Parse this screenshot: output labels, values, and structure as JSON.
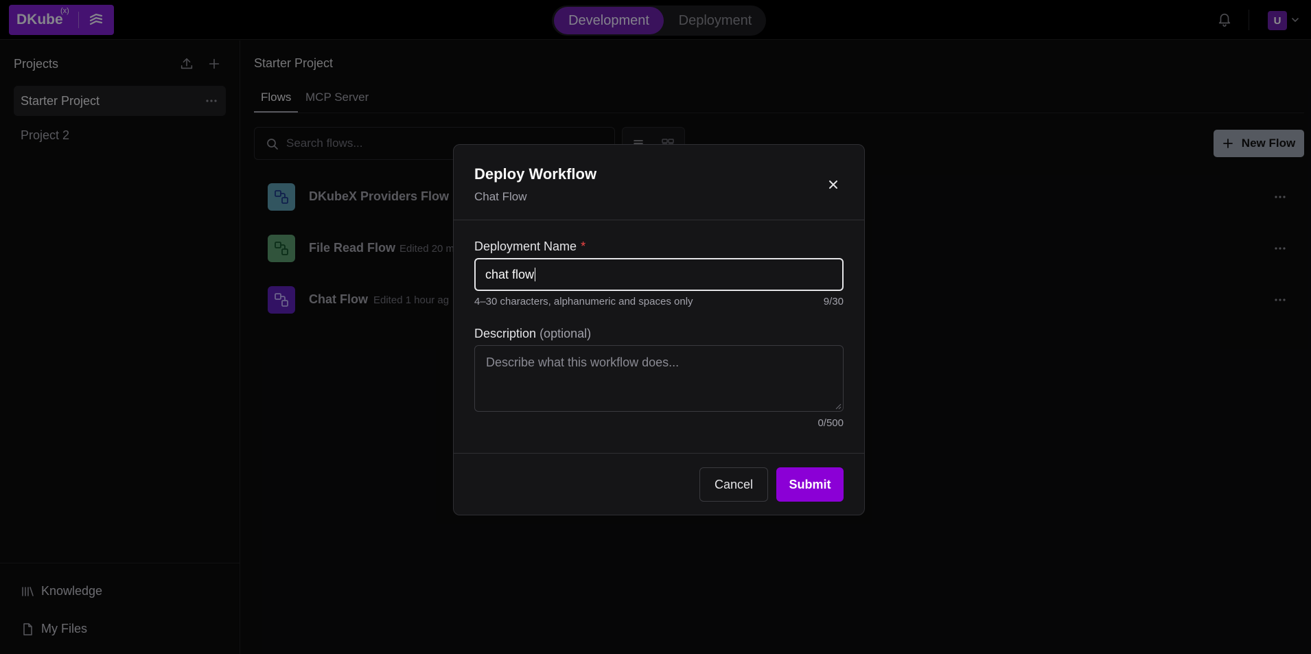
{
  "colors": {
    "brand": "#7e22ce",
    "submit": "#8b00d6",
    "required_star": "#ef4444",
    "flow_icon_1": "#5b9bb0",
    "flow_icon_2": "#5a9a6e",
    "flow_icon_3": "#5b21b6"
  },
  "header": {
    "logo_text": "DKube",
    "logo_sup": "(x)",
    "logo_icon": "flow-mark-icon",
    "modes": [
      "Development",
      "Deployment"
    ],
    "active_mode": "Development",
    "notification_icon": "bell-icon",
    "avatar_initial": "U"
  },
  "sidebar": {
    "title": "Projects",
    "upload_icon": "upload-icon",
    "add_icon": "plus-icon",
    "projects": [
      {
        "label": "Starter Project",
        "active": true
      },
      {
        "label": "Project 2",
        "active": false
      }
    ],
    "footer_links": [
      {
        "label": "Knowledge",
        "icon": "library-icon"
      },
      {
        "label": "My Files",
        "icon": "file-icon"
      }
    ]
  },
  "main": {
    "breadcrumb": "Starter Project",
    "tabs": [
      "Flows",
      "MCP Server"
    ],
    "active_tab": "Flows",
    "search_placeholder": "Search flows...",
    "new_flow_label": "New Flow",
    "flows": [
      {
        "name": "DKubeX Providers Flow",
        "meta": "",
        "icon": "workflow-icon"
      },
      {
        "name": "File Read Flow",
        "meta": "Edited 20 m",
        "icon": "workflow-icon"
      },
      {
        "name": "Chat Flow",
        "meta": "Edited 1 hour ag",
        "icon": "workflow-icon"
      }
    ]
  },
  "modal": {
    "title": "Deploy Workflow",
    "subtitle": "Chat Flow",
    "name_label": "Deployment Name",
    "name_required": "*",
    "name_value": "chat flow",
    "name_hint": "4–30 characters, alphanumeric and spaces only",
    "name_count": "9/30",
    "desc_label": "Description",
    "desc_optional": "(optional)",
    "desc_placeholder": "Describe what this workflow does...",
    "desc_count": "0/500",
    "cancel_label": "Cancel",
    "submit_label": "Submit"
  }
}
